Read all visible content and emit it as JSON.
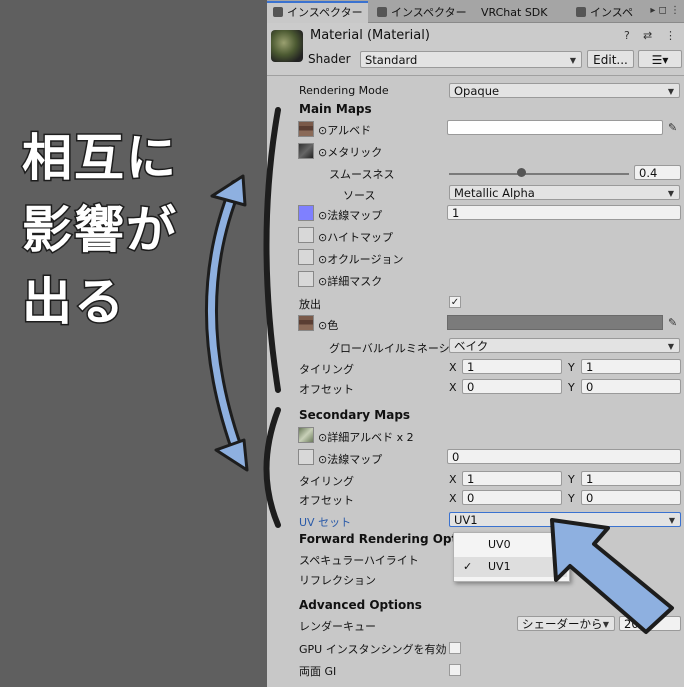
{
  "tabs": [
    {
      "label": "インスペクター",
      "active": true
    },
    {
      "label": "インスペクター",
      "active": false
    },
    {
      "label": "VRChat SDK",
      "active": false
    },
    {
      "label": "インスペ",
      "active": false
    }
  ],
  "header": {
    "title": "Material (Material)",
    "shader_label": "Shader",
    "shader_value": "Standard",
    "edit_button": "Edit...",
    "list_button": "☰▾"
  },
  "main": {
    "rendering_mode_label": "Rendering Mode",
    "rendering_mode_value": "Opaque",
    "main_maps_title": "Main Maps",
    "albedo_label": "⊙アルベド",
    "metallic_label": "⊙メタリック",
    "smoothness_label": "スムースネス",
    "smoothness_value": "0.4",
    "smoothness_level": 0.4,
    "source_label": "ソース",
    "source_value": "Metallic Alpha",
    "normal_label": "⊙法線マップ",
    "normal_value": "1",
    "height_label": "⊙ハイトマップ",
    "occlusion_label": "⊙オクルージョン",
    "detail_mask_label": "⊙詳細マスク",
    "emission_label": "放出",
    "emission_checked": true,
    "emission_color_label": "⊙色",
    "gi_label": "グローバルイルミネーション",
    "gi_value": "ベイク",
    "tiling_label": "タイリング",
    "tiling_x": "1",
    "tiling_y": "1",
    "offset_label": "オフセット",
    "offset_x": "0",
    "offset_y": "0",
    "x": "X",
    "y": "Y"
  },
  "secondary": {
    "title": "Secondary Maps",
    "detail_albedo_label": "⊙詳細アルベド x 2",
    "normal_label": "⊙法線マップ",
    "normal_value": "0",
    "tiling_label": "タイリング",
    "tiling_x": "1",
    "tiling_y": "1",
    "offset_label": "オフセット",
    "offset_x": "0",
    "offset_y": "0",
    "uv_label": "UV セット",
    "uv_value": "UV1"
  },
  "forward": {
    "title": "Forward Rendering Opt",
    "specular_label": "スペキュラーハイライト",
    "reflection_label": "リフレクション"
  },
  "uv_popup": {
    "options": [
      "UV0",
      "UV1"
    ],
    "selected": "UV1",
    "check": "✓"
  },
  "advanced": {
    "title": "Advanced Options",
    "render_queue_label": "レンダーキュー",
    "render_queue_mode": "シェーダーから",
    "render_queue_value": "2000",
    "gpu_instancing_label": "GPU インスタンシングを有効にす",
    "double_gi_label": "両面 GI"
  },
  "annotation": {
    "line1": "相互に",
    "line2": "影響が",
    "line3": "出る"
  },
  "colors": {
    "accent_tab": "#3a72d0",
    "arrow_fill": "#8eb0e0",
    "arrow_stroke": "#1d1d1d",
    "uv_label_color": "#2a5aa8"
  }
}
